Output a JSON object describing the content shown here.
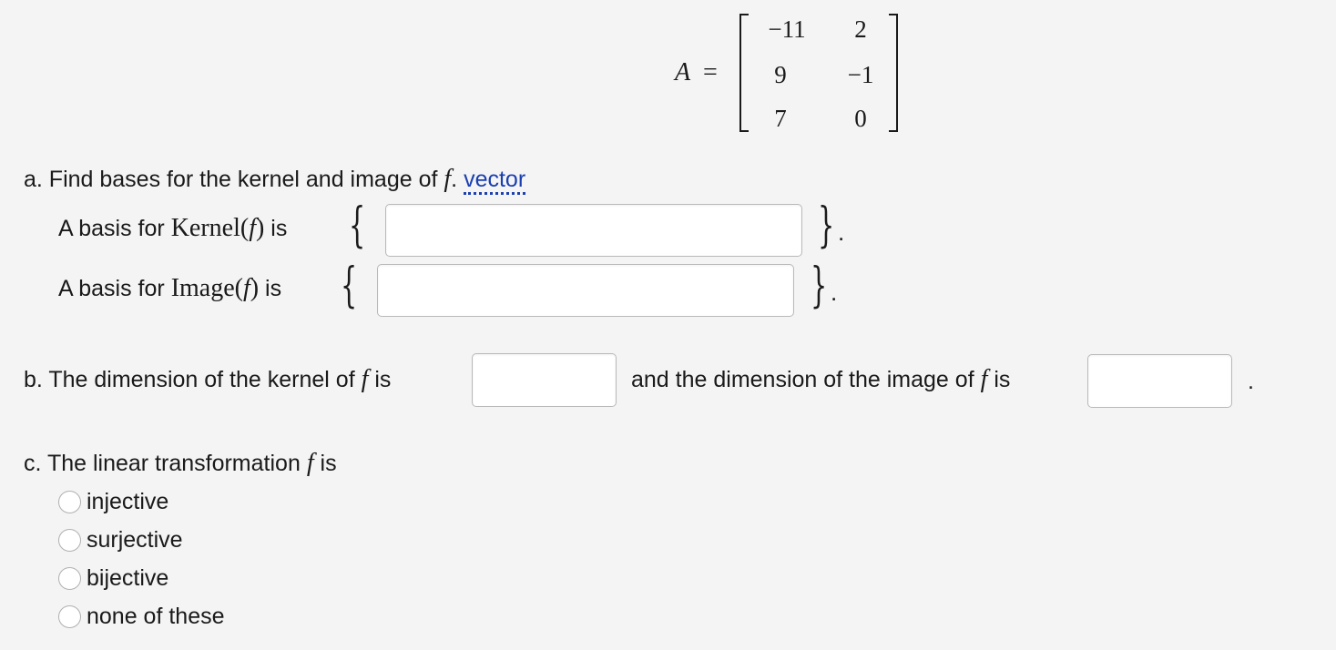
{
  "matrix": {
    "name": "A",
    "equals": "=",
    "rows": [
      [
        "−11",
        "2"
      ],
      [
        "9",
        "−1"
      ],
      [
        "7",
        "0"
      ]
    ]
  },
  "part_a": {
    "prefix": "a. Find bases for the kernel and image of",
    "f": "f",
    "period": ".",
    "vector_link": "vector",
    "kernel_label_pre": "A basis for",
    "kernel_math": "Kernel(",
    "kernel_f": "f",
    "kernel_close": ")",
    "kernel_is": "is",
    "image_label_pre": "A basis for",
    "image_math": "Image(",
    "image_f": "f",
    "image_close": ")",
    "image_is": "is",
    "brace_open": "{",
    "brace_close": "}",
    "dot": ".",
    "kernel_value": "",
    "image_value": ""
  },
  "part_b": {
    "prefix": "b. The dimension of the kernel of",
    "f1": "f",
    "is1": "is",
    "middle": "and the dimension of the image of",
    "f2": "f",
    "is2": "is",
    "end": ".",
    "kernel_dim_value": "",
    "image_dim_value": ""
  },
  "part_c": {
    "prefix": "c. The linear transformation",
    "f": "f",
    "is": "is",
    "options": [
      "injective",
      "surjective",
      "bijective",
      "none of these"
    ]
  }
}
